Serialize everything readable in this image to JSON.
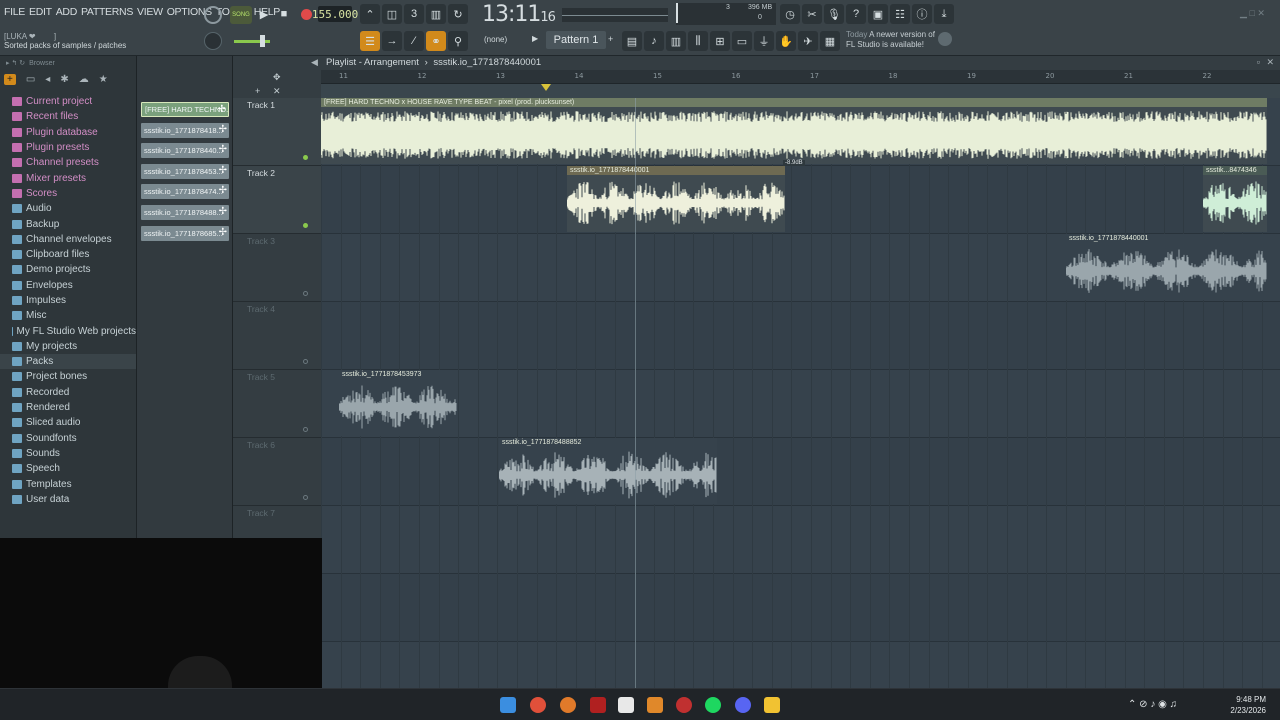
{
  "menu": [
    "FILE",
    "EDIT",
    "ADD",
    "PATTERNS",
    "VIEW",
    "OPTIONS",
    "TOOLS",
    "HELP"
  ],
  "transport": {
    "song_label": "SONG",
    "tempo": "155.000",
    "time_main": "13:11",
    "time_sub": "16"
  },
  "cpu": {
    "mem": "396 MB",
    "cpu_val": "3",
    "poly": "0"
  },
  "hint": {
    "line1": "[LUKA ❤",
    "line1_extra": "]",
    "line2": "Sorted packs of samples / patches"
  },
  "pattern": {
    "none_label": "(none)",
    "name": "Pattern 1"
  },
  "news": {
    "today": "Today",
    "line1": "A newer version of",
    "line2": "FL Studio is available!"
  },
  "browser": {
    "header": "Browser",
    "items": [
      {
        "label": "Current project",
        "style": "pink"
      },
      {
        "label": "Recent files",
        "style": "pink"
      },
      {
        "label": "Plugin database",
        "style": "pink"
      },
      {
        "label": "Plugin presets",
        "style": "pink"
      },
      {
        "label": "Channel presets",
        "style": "pink"
      },
      {
        "label": "Mixer presets",
        "style": "pink"
      },
      {
        "label": "Scores",
        "style": "pink"
      },
      {
        "label": "Audio",
        "style": "normal"
      },
      {
        "label": "Backup",
        "style": "normal"
      },
      {
        "label": "Channel envelopes",
        "style": "normal"
      },
      {
        "label": "Clipboard files",
        "style": "normal"
      },
      {
        "label": "Demo projects",
        "style": "normal"
      },
      {
        "label": "Envelopes",
        "style": "normal"
      },
      {
        "label": "Impulses",
        "style": "normal"
      },
      {
        "label": "Misc",
        "style": "normal"
      },
      {
        "label": "My FL Studio Web projects",
        "style": "normal"
      },
      {
        "label": "My projects",
        "style": "normal"
      },
      {
        "label": "Packs",
        "style": "active"
      },
      {
        "label": "Project bones",
        "style": "normal"
      },
      {
        "label": "Recorded",
        "style": "normal"
      },
      {
        "label": "Rendered",
        "style": "normal"
      },
      {
        "label": "Sliced audio",
        "style": "normal"
      },
      {
        "label": "Soundfonts",
        "style": "normal"
      },
      {
        "label": "Sounds",
        "style": "normal"
      },
      {
        "label": "Speech",
        "style": "normal"
      },
      {
        "label": "Templates",
        "style": "normal"
      },
      {
        "label": "User data",
        "style": "normal"
      }
    ]
  },
  "clips_list": [
    {
      "label": "[FREE] HARD TECHNO...",
      "selected": true
    },
    {
      "label": "ssstik.io_17718784­18...",
      "selected": false
    },
    {
      "label": "ssstik.io_17718784­40...",
      "selected": false
    },
    {
      "label": "ssstik.io_17718784­53...",
      "selected": false
    },
    {
      "label": "ssstik.io_17718784­74...",
      "selected": false
    },
    {
      "label": "ssstik.io_17718784­88...",
      "selected": false
    },
    {
      "label": "ssstik.io_17718786­85...",
      "selected": false
    }
  ],
  "playlist": {
    "title_prefix": "Playlist - Arrangement",
    "title_sep": "›",
    "current": "ssstik.io_1771878440001",
    "ruler": [
      "11",
      "12",
      "13",
      "14",
      "15",
      "16",
      "17",
      "18",
      "19",
      "20",
      "21",
      "22"
    ],
    "tracks": [
      "Track 1",
      "Track 2",
      "Track 3",
      "Track 4",
      "Track 5",
      "Track 6",
      "Track 7"
    ],
    "clips": [
      {
        "name": "[FREE] HARD TECHNO x HOUSE RAVE TYPE BEAT - pixel (prod. plucksunset)",
        "track": 1
      },
      {
        "name": "ssstik.io_1771878440001",
        "track": 2
      },
      {
        "name": "ssstik...8474346",
        "track": 2
      },
      {
        "name": "ssstik.io_1771878440001",
        "track": 3
      },
      {
        "name": "ssstik.io_1771878453973",
        "track": 5
      },
      {
        "name": "ssstik.io_1771878488852",
        "track": 6
      }
    ],
    "volume_hint": "-8.9dB"
  },
  "clock": {
    "time": "9:48 PM",
    "date": "2/23/2026"
  }
}
